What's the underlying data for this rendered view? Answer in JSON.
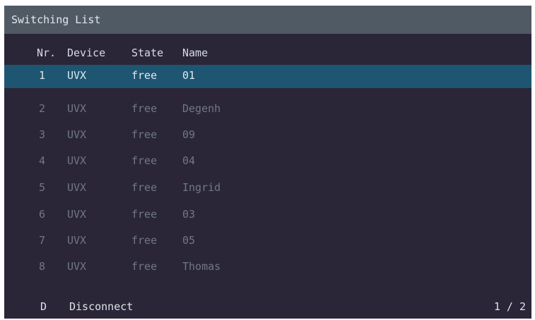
{
  "title": "Switching List",
  "columns": {
    "nr": "Nr.",
    "device": "Device",
    "state": "State",
    "name": "Name"
  },
  "rows": [
    {
      "nr": "1",
      "device": "UVX",
      "state": "free",
      "name": "01",
      "selected": true
    },
    {
      "nr": "2",
      "device": "UVX",
      "state": "free",
      "name": "Degenh",
      "selected": false
    },
    {
      "nr": "3",
      "device": "UVX",
      "state": "free",
      "name": "09",
      "selected": false
    },
    {
      "nr": "4",
      "device": "UVX",
      "state": "free",
      "name": "04",
      "selected": false
    },
    {
      "nr": "5",
      "device": "UVX",
      "state": "free",
      "name": "Ingrid",
      "selected": false
    },
    {
      "nr": "6",
      "device": "UVX",
      "state": "free",
      "name": "03",
      "selected": false
    },
    {
      "nr": "7",
      "device": "UVX",
      "state": "free",
      "name": "05",
      "selected": false
    },
    {
      "nr": "8",
      "device": "UVX",
      "state": "free",
      "name": "Thomas",
      "selected": false
    }
  ],
  "footer": {
    "key": "D",
    "action": "Disconnect",
    "page": "1 / 2"
  },
  "colors": {
    "background": "#2a2638",
    "title_bar": "#505a64",
    "selected_row": "#1e5672"
  }
}
